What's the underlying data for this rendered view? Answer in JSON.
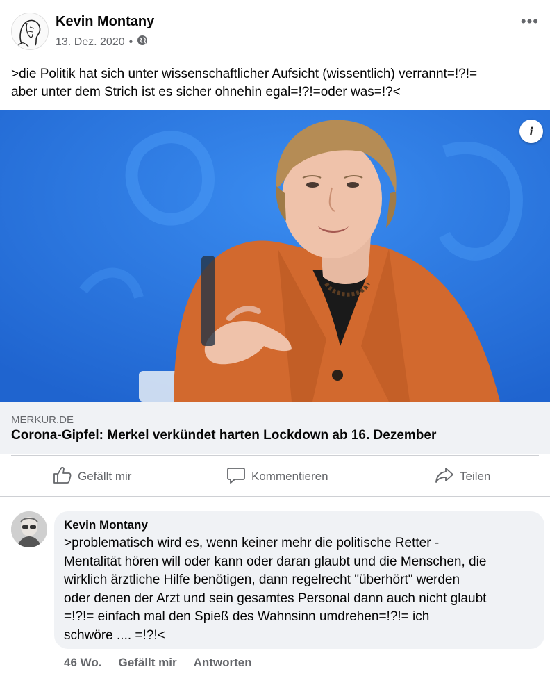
{
  "post": {
    "author": "Kevin Montany",
    "date": "13. Dez. 2020",
    "separator": "•",
    "more": "•••",
    "text_line1": ">die Politik hat sich unter  wissenschaftlicher Aufsicht (wissentlich)  verrannt=!?!=",
    "text_line2": "aber unter dem Strich ist es sicher ohnehin egal=!?!=oder was=!?<"
  },
  "link": {
    "info": "i",
    "domain": "MERKUR.DE",
    "title": "Corona-Gipfel: Merkel verkündet harten Lockdown ab 16. Dezember"
  },
  "actions": {
    "like": "Gefällt mir",
    "comment": "Kommentieren",
    "share": "Teilen"
  },
  "comment": {
    "author": "Kevin Montany",
    "lines": [
      ">problematisch wird es, wenn keiner mehr die politische Retter -",
      "Mentalität hören will oder kann oder daran glaubt und die Menschen, die",
      "wirklich ärztliche Hilfe benötigen, dann regelrecht \"überhört\" werden",
      "oder denen der Arzt und sein gesamtes Personal dann auch nicht glaubt",
      "=!?!= einfach mal den Spieß des Wahnsinn umdrehen=!?!= ich",
      "schwöre .... =!?!<"
    ],
    "age": "46 Wo.",
    "like": "Gefällt mir",
    "reply": "Antworten"
  },
  "colors": {
    "accent": "#65676b",
    "image_bg": "#2a78e2",
    "jacket": "#d2692e",
    "bubble": "#f0f2f5"
  },
  "icons": [
    "globe-icon",
    "thumbs-up-icon",
    "comment-icon",
    "share-icon",
    "info-icon",
    "more-icon"
  ]
}
